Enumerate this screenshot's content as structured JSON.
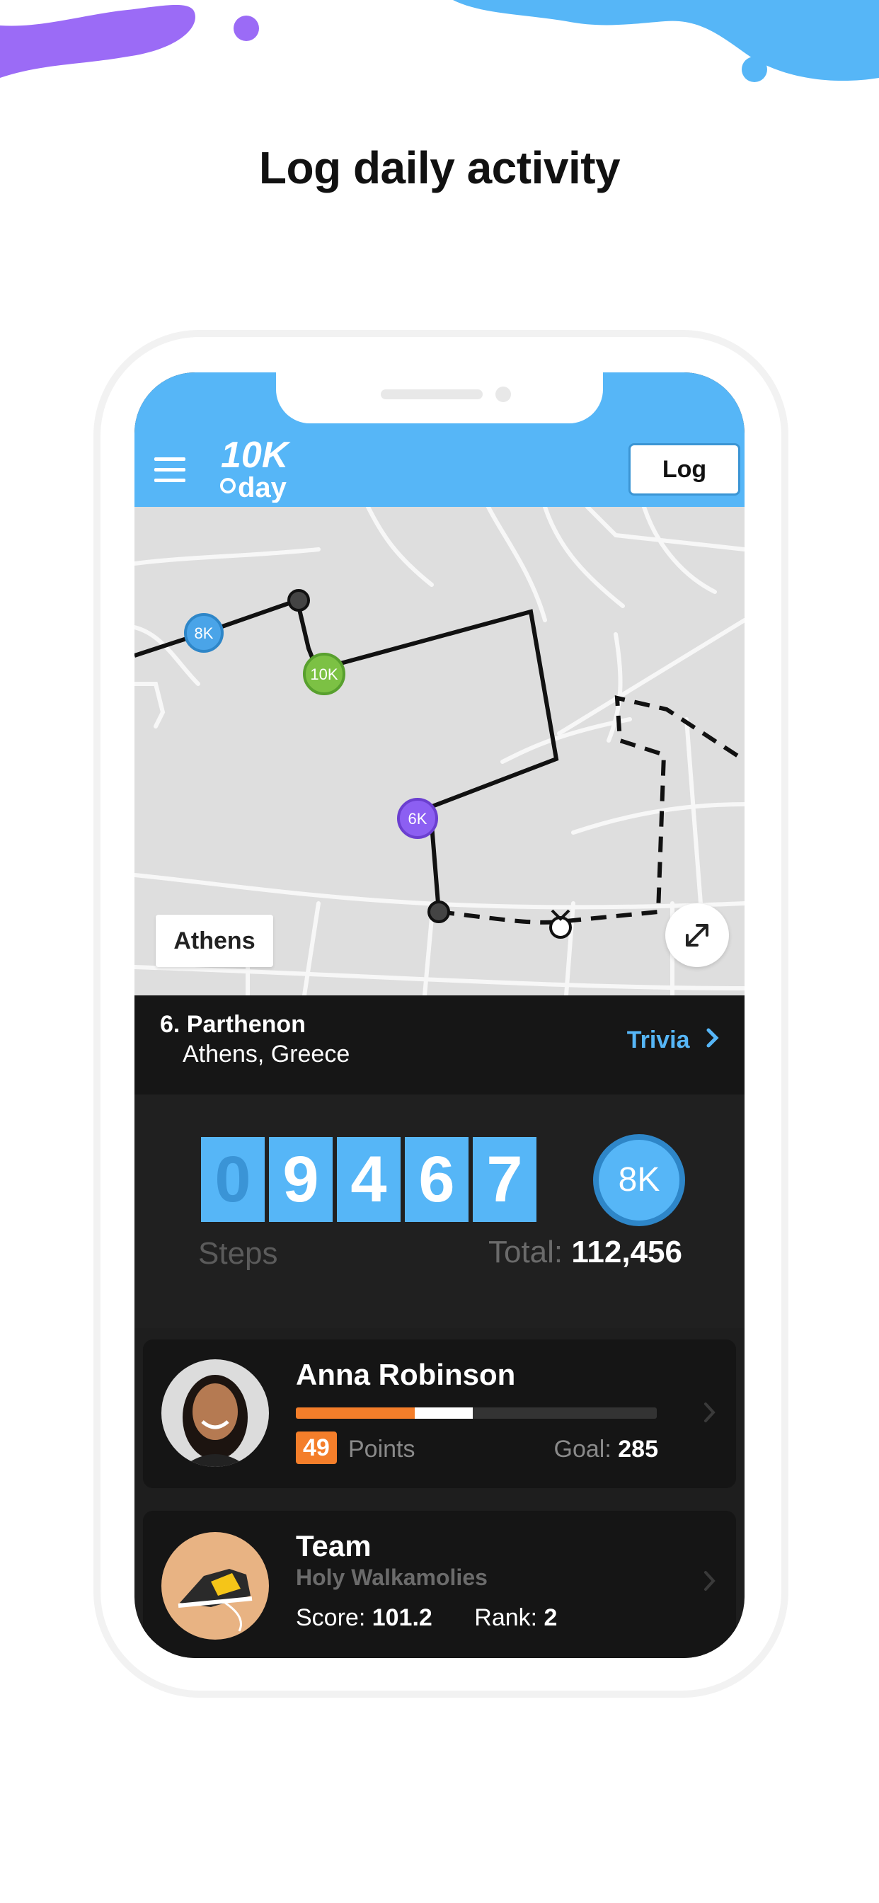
{
  "hero": {
    "title": "Log daily activity"
  },
  "header": {
    "logo_alt": "10K a day",
    "log_button": "Log"
  },
  "map": {
    "city_label": "Athens",
    "markers": [
      "8K",
      "10K",
      "6K"
    ]
  },
  "location": {
    "title": "6. Parthenon",
    "subtitle": "Athens, Greece",
    "trivia_label": "Trivia"
  },
  "stats": {
    "digits": [
      "0",
      "9",
      "4",
      "6",
      "7"
    ],
    "steps_label": "Steps",
    "total_label": "Total:",
    "total_value": "112,456",
    "level_badge": "8K"
  },
  "user_card": {
    "name": "Anna Robinson",
    "progress_primary": 0.33,
    "progress_secondary": 0.16,
    "points_value": "49",
    "points_label": "Points",
    "goal_label": "Goal:",
    "goal_value": "285"
  },
  "team_card": {
    "title": "Team",
    "name": "Holy Walkamolies",
    "score_label": "Score:",
    "score_value": "101.2",
    "rank_label": "Rank:",
    "rank_value": "2"
  },
  "colors": {
    "accent": "#56b6f7",
    "orange": "#f47e2a",
    "green": "#7cc144",
    "purple": "#8c5ff2",
    "dark": "#1e1e1e"
  }
}
